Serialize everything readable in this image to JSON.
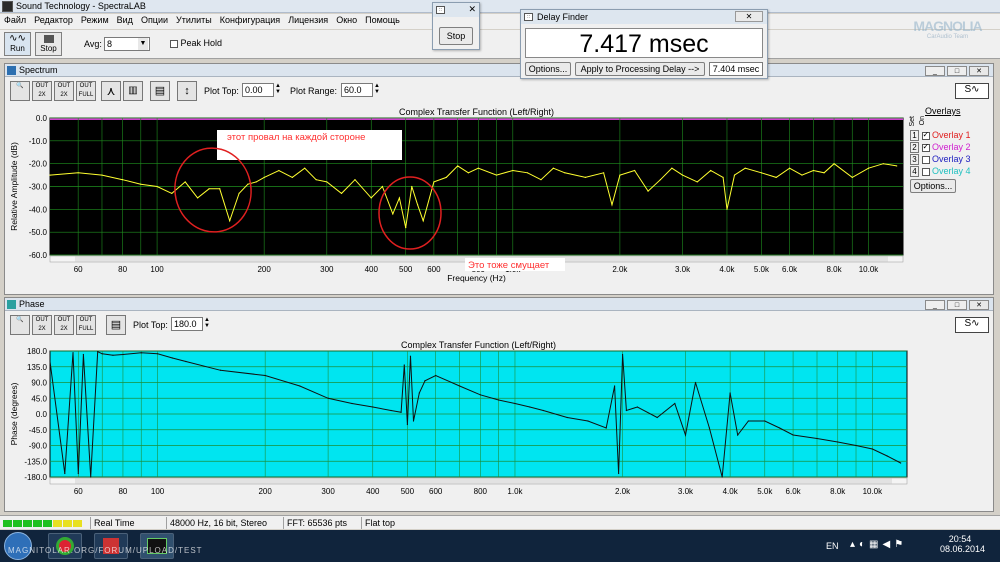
{
  "app": {
    "title": "Sound Technology - SpectraLAB"
  },
  "menu": [
    "Файл",
    "Редактор",
    "Режим",
    "Вид",
    "Опции",
    "Утилиты",
    "Конфигурация",
    "Лицензия",
    "Окно",
    "Помощь"
  ],
  "toolbar": {
    "run": "Run",
    "stop": "Stop",
    "avg_label": "Avg:",
    "avg_value": "8",
    "peak_hold": "Peak Hold",
    "peak_hold_checked": false
  },
  "stop_dialog": {
    "button": "Stop"
  },
  "delay_finder": {
    "title": "Delay Finder",
    "value": "7.417 msec",
    "options": "Options...",
    "apply": "Apply to Processing Delay -->",
    "delay_value": "7.404 msec"
  },
  "watermark": {
    "main": "MAGNOLIA",
    "sub": "CarAudio Team"
  },
  "spectrum": {
    "panel_title": "Spectrum",
    "plot_top_label": "Plot Top:",
    "plot_top_value": "0.00",
    "plot_range_label": "Plot Range:",
    "plot_range_value": "60.0",
    "chart_title": "Complex Transfer Function (Left/Right)",
    "ylabel": "Relative Amplitude (dB)",
    "xlabel": "Frequency (Hz)",
    "yticks": [
      "0.0",
      "-10.0",
      "-20.0",
      "-30.0",
      "-40.0",
      "-50.0",
      "-60.0"
    ],
    "xticks": [
      "60",
      "80",
      "100",
      "200",
      "300",
      "400",
      "500",
      "600",
      "800",
      "1.0k",
      "2.0k",
      "3.0k",
      "4.0k",
      "5.0k",
      "6.0k",
      "8.0k",
      "10.0k"
    ],
    "annotation1": "этот провал на каждой стороне",
    "annotation2": "Это тоже смущает",
    "overlays_header": "Overlays",
    "set_label": "Set",
    "on_label": "On",
    "overlays": [
      {
        "num": "1",
        "label": "Overlay 1",
        "checked": true,
        "color": "#e02020"
      },
      {
        "num": "2",
        "label": "Overlay 2",
        "checked": true,
        "color": "#d020d0"
      },
      {
        "num": "3",
        "label": "Overlay 3",
        "checked": false,
        "color": "#2020c0"
      },
      {
        "num": "4",
        "label": "Overlay 4",
        "checked": false,
        "color": "#20c0c0"
      }
    ],
    "options_button": "Options..."
  },
  "phase": {
    "panel_title": "Phase",
    "plot_top_label": "Plot Top:",
    "plot_top_value": "180.0",
    "chart_title": "Complex Transfer Function (Left/Right)",
    "ylabel": "Phase (degrees)",
    "yticks": [
      "180.0",
      "135.0",
      "90.0",
      "45.0",
      "0.0",
      "-45.0",
      "-90.0",
      "-135.0",
      "-180.0"
    ],
    "xticks": [
      "60",
      "80",
      "100",
      "200",
      "300",
      "400",
      "500",
      "600",
      "800",
      "1.0k",
      "2.0k",
      "3.0k",
      "4.0k",
      "5.0k",
      "6.0k",
      "8.0k",
      "10.0k"
    ]
  },
  "chart_data": [
    {
      "type": "line",
      "title": "Complex Transfer Function (Left/Right)",
      "xlabel": "Frequency (Hz)",
      "ylabel": "Relative Amplitude (dB)",
      "x_scale": "log",
      "xlim": [
        50,
        12500
      ],
      "ylim": [
        -60,
        0
      ],
      "grid": true,
      "series": [
        {
          "x": [
            50,
            60,
            70,
            80,
            90,
            100,
            110,
            120,
            130,
            140,
            150,
            160,
            170,
            180,
            190,
            200,
            220,
            240,
            260,
            280,
            300,
            330,
            360,
            400,
            430,
            460,
            480,
            500,
            520,
            540,
            560,
            600,
            650,
            700,
            750,
            800,
            900,
            1000,
            1100,
            1200,
            1300,
            1400,
            1600,
            1800,
            1900,
            2000,
            2200,
            2400,
            2600,
            2800,
            3000,
            3300,
            3600,
            3900,
            4000,
            4200,
            4500,
            5000,
            5500,
            6000,
            6500,
            7000,
            7500,
            8000,
            9000,
            10000,
            11000,
            12000
          ],
          "values": [
            -25,
            -24,
            -25,
            -27,
            -29,
            -30,
            -33,
            -28,
            -35,
            -31,
            -31,
            -45,
            -33,
            -29,
            -28,
            -26,
            -23,
            -26,
            -22,
            -27,
            -28,
            -33,
            -27,
            -35,
            -30,
            -42,
            -35,
            -48,
            -30,
            -38,
            -45,
            -28,
            -26,
            -21,
            -24,
            -22,
            -25,
            -23,
            -24,
            -27,
            -22,
            -24,
            -26,
            -24,
            -38,
            -25,
            -23,
            -32,
            -27,
            -22,
            -25,
            -28,
            -23,
            -26,
            -40,
            -25,
            -22,
            -24,
            -26,
            -22,
            -25,
            -23,
            -24,
            -20,
            -26,
            -22,
            -20,
            -21
          ]
        }
      ]
    },
    {
      "type": "line",
      "title": "Complex Transfer Function (Left/Right)",
      "xlabel": "Frequency (Hz)",
      "ylabel": "Phase (degrees)",
      "x_scale": "log",
      "xlim": [
        50,
        12500
      ],
      "ylim": [
        -180,
        180
      ],
      "grid": true,
      "series": [
        {
          "x": [
            50,
            55,
            58,
            60,
            62,
            65,
            68,
            70,
            75,
            80,
            90,
            100,
            110,
            120,
            150,
            200,
            250,
            300,
            350,
            400,
            450,
            480,
            490,
            500,
            510,
            520,
            540,
            560,
            600,
            700,
            800,
            900,
            1000,
            1100,
            1200,
            1400,
            1600,
            1800,
            1900,
            1950,
            2000,
            2050,
            2200,
            2500,
            2800,
            3000,
            3200,
            3500,
            3800,
            4000,
            4200,
            4500,
            5000,
            5500,
            6000,
            7000,
            8000,
            9000,
            10000,
            11000,
            12000
          ],
          "values": [
            150,
            -170,
            175,
            -170,
            170,
            -180,
            178,
            172,
            168,
            170,
            175,
            172,
            160,
            150,
            125,
            110,
            80,
            45,
            30,
            20,
            10,
            5,
            140,
            -30,
            165,
            -20,
            60,
            95,
            110,
            80,
            55,
            40,
            30,
            20,
            10,
            -10,
            -20,
            -40,
            80,
            -170,
            170,
            10,
            20,
            -10,
            30,
            -60,
            90,
            -40,
            -180,
            60,
            -60,
            -20,
            -20,
            -40,
            -60,
            -70,
            -80,
            -90,
            -100,
            -120,
            -140
          ]
        }
      ]
    }
  ],
  "status": {
    "mode": "Real Time",
    "format": "48000 Hz, 16 bit, Stereo",
    "fft": "FFT: 65536 pts",
    "window": "Flat top"
  },
  "taskbar": {
    "url_text": "MAGNITOLAR.ORG/FORUM/UPLOAD/TEST",
    "lang": "EN",
    "time": "20:54",
    "date": "08.06.2014"
  }
}
